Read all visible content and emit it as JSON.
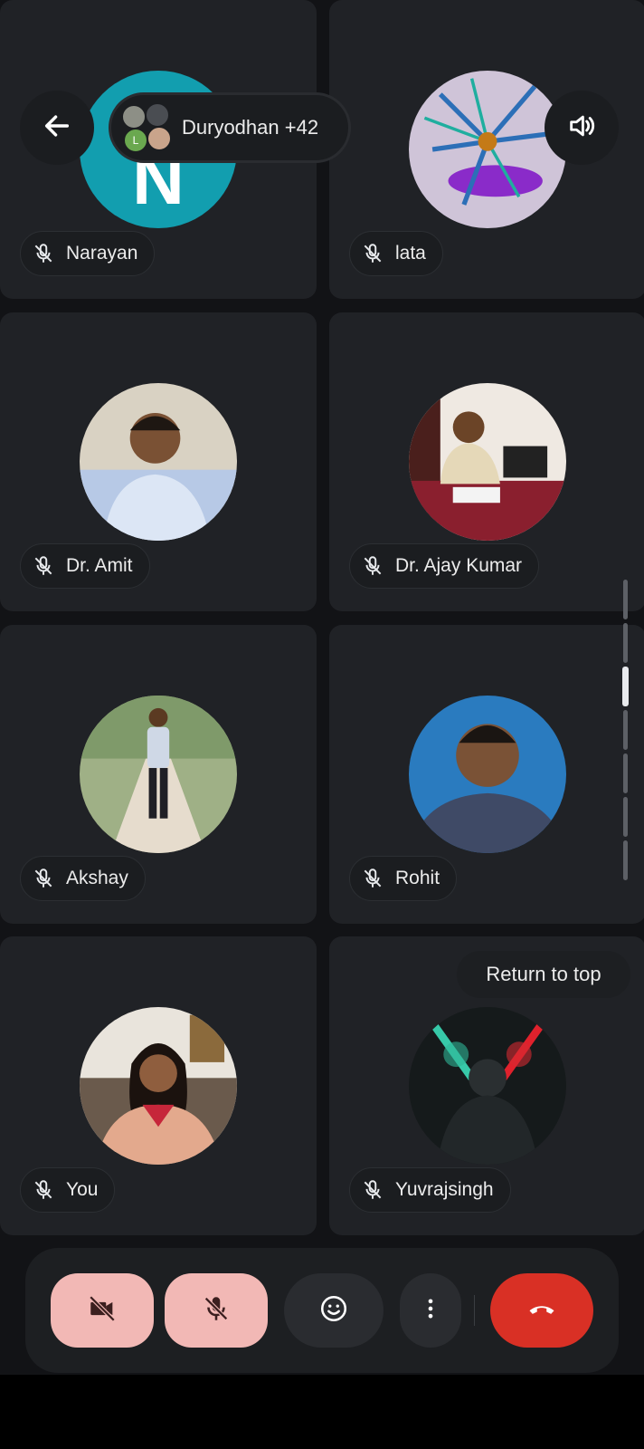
{
  "top_bar": {
    "participants_label": "Duryodhan +42",
    "mini_avatar_letter": "L"
  },
  "participants": [
    {
      "name": "Narayan",
      "avatar_letter": "N",
      "avatar_color": "#129eaf",
      "muted": true
    },
    {
      "name": "lata",
      "muted": true
    },
    {
      "name": "Dr. Amit",
      "muted": true
    },
    {
      "name": "Dr. Ajay Kumar",
      "muted": true
    },
    {
      "name": "Akshay",
      "muted": true
    },
    {
      "name": "Rohit",
      "muted": true
    },
    {
      "name": "You",
      "muted": true
    },
    {
      "name": "Yuvrajsingh",
      "muted": true
    }
  ],
  "return_to_top_label": "Return to top",
  "controls": {
    "camera": {
      "icon": "camera-off-icon",
      "state": "off"
    },
    "mic": {
      "icon": "mic-off-icon",
      "state": "off"
    },
    "reactions": {
      "icon": "emoji-icon"
    },
    "more": {
      "icon": "more-vert-icon"
    },
    "hangup": {
      "icon": "call-end-icon"
    }
  },
  "colors": {
    "tile_bg": "#202226",
    "control_off_bg": "#f2b8b5",
    "hangup_bg": "#d93025",
    "accent_teal": "#129eaf"
  }
}
